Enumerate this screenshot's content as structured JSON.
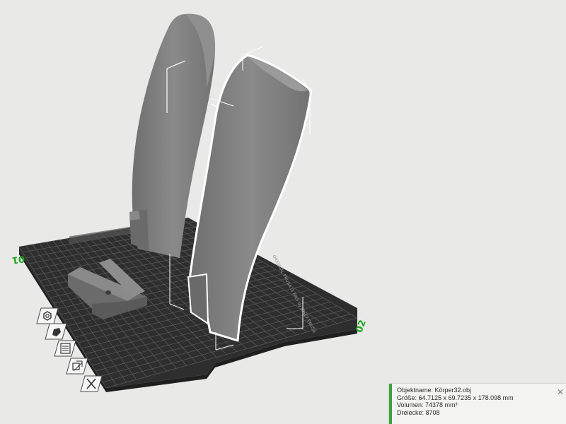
{
  "bed": {
    "label_left": "01",
    "label_right": "02",
    "brand_text": "ORIGINAL PRUSA i3 MK3 by JOSEF PRUSA"
  },
  "toolbar": {
    "items": [
      {
        "name": "add-part",
        "icon": "hexagon-nut-icon"
      },
      {
        "name": "object-settings",
        "icon": "pen-icon"
      },
      {
        "name": "layers",
        "icon": "layers-list-icon"
      },
      {
        "name": "arrange",
        "icon": "arrange-icon"
      },
      {
        "name": "delete",
        "icon": "close-icon"
      }
    ]
  },
  "object_info": {
    "name_line": "Objektname: Körper32.obj",
    "size_line": "Größe: 64.7125 x 69.7235 x 178.098 mm",
    "volume_line": "Volumen: 74378 mm³",
    "triangles_line": "Dreiecke: 8708"
  },
  "colors": {
    "background": "#e9e9e8",
    "bed": "#2f2f2f",
    "grid": "#4e4e4e",
    "model": "#7d7d7d",
    "accent": "#1aa61a"
  }
}
